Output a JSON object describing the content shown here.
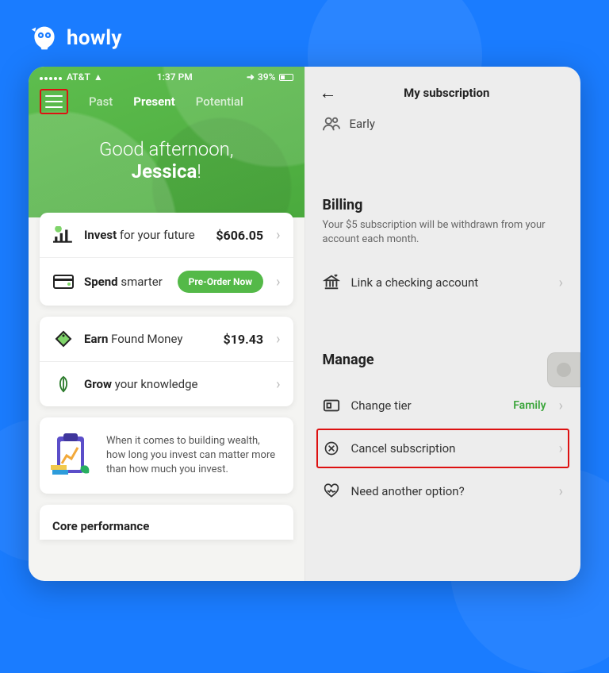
{
  "brand": {
    "name": "howly"
  },
  "left": {
    "status": {
      "carrier": "AT&T",
      "time": "1:37 PM",
      "battery": "39%"
    },
    "tabs": {
      "past": "Past",
      "present": "Present",
      "potential": "Potential"
    },
    "greeting": {
      "line": "Good afternoon,",
      "name": "Jessica",
      "bang": "!"
    },
    "invest": {
      "bold": "Invest",
      "rest": " for your future",
      "value": "$606.05"
    },
    "spend": {
      "bold": "Spend",
      "rest": " smarter",
      "cta": "Pre-Order Now"
    },
    "earn": {
      "bold": "Earn",
      "rest": " Found Money",
      "value": "$19.43"
    },
    "grow": {
      "bold": "Grow",
      "rest": " your knowledge"
    },
    "promo": "When it comes to building wealth, how long you invest can matter more than how much you invest.",
    "core": "Core performance"
  },
  "right": {
    "title": "My subscription",
    "early": "Early",
    "billing": {
      "heading": "Billing",
      "sub": "Your $5 subscription will be withdrawn from your account each month.",
      "link": "Link a checking account"
    },
    "manage": {
      "heading": "Manage",
      "change": "Change tier",
      "tier": "Family",
      "cancel": "Cancel subscription",
      "need": "Need another option?"
    }
  }
}
